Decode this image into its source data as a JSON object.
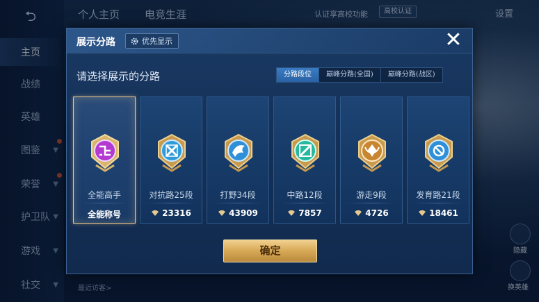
{
  "background": {
    "back_label": "⮌",
    "nav_items": [
      {
        "label": "主页",
        "active": true,
        "dot": false
      },
      {
        "label": "战绩",
        "active": false,
        "dot": false
      },
      {
        "label": "英雄",
        "active": false,
        "dot": false
      },
      {
        "label": "图鉴",
        "active": false,
        "dot": true
      },
      {
        "label": "荣誉",
        "active": false,
        "dot": true
      },
      {
        "label": "护卫队",
        "active": false,
        "dot": false
      },
      {
        "label": "游戏",
        "active": false,
        "dot": false
      },
      {
        "label": "社交",
        "active": false,
        "dot": false
      }
    ],
    "top_tabs": [
      "个人主页",
      "电竞生涯"
    ],
    "campus_text": "认证享高校功能",
    "campus_badge": "高校认证",
    "settings_label": "设置",
    "recent_visitors": "最近访客>",
    "right_labels": [
      "隐藏",
      "换英雄"
    ]
  },
  "modal": {
    "title": "展示分路",
    "priority_label": "优先显示",
    "close_label": "✕",
    "prompt": "请选择展示的分路",
    "segments": [
      {
        "label": "分路段位",
        "active": true
      },
      {
        "label": "巅峰分路(全国)",
        "active": false
      },
      {
        "label": "巅峰分路(战区)",
        "active": false
      }
    ],
    "cards": [
      {
        "label": "全能高手",
        "value": "全能称号",
        "show_icon": false,
        "selected": true,
        "emblem": "all-round-emblem",
        "color": "#b23ad1"
      },
      {
        "label": "对抗路25段",
        "value": "23316",
        "show_icon": true,
        "selected": false,
        "emblem": "clash-lane-emblem",
        "color": "#2f9bd8"
      },
      {
        "label": "打野34段",
        "value": "43909",
        "show_icon": true,
        "selected": false,
        "emblem": "jungle-emblem",
        "color": "#2f8fd8"
      },
      {
        "label": "中路12段",
        "value": "7857",
        "show_icon": true,
        "selected": false,
        "emblem": "mid-lane-emblem",
        "color": "#27b8a0"
      },
      {
        "label": "游走9段",
        "value": "4726",
        "show_icon": true,
        "selected": false,
        "emblem": "roam-emblem",
        "color": "#c7862f"
      },
      {
        "label": "发育路21段",
        "value": "18461",
        "show_icon": true,
        "selected": false,
        "emblem": "farm-lane-emblem",
        "color": "#2f8fd8"
      }
    ],
    "confirm_label": "确定"
  }
}
